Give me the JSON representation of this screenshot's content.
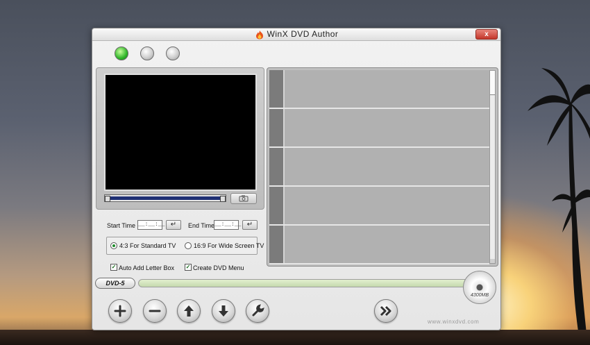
{
  "window": {
    "title": "WinX DVD Author",
    "close_label": "x"
  },
  "inputs": {
    "start_label": "Start Time :",
    "start_value": "__:__:__",
    "end_label": "End Time :",
    "end_value": "__:__:__",
    "enter_glyph": "↵"
  },
  "aspect": {
    "option_43": "4:3 For Standard TV",
    "option_169": "16:9 For Wide Screen TV",
    "selected": "4:3 For Standard TV"
  },
  "options": {
    "letterbox_label": "Auto Add Letter Box",
    "letterbox_checked": true,
    "menu_label": "Create DVD Menu",
    "menu_checked": true
  },
  "disc": {
    "type_label": "DVD-5",
    "capacity_label": "4300MB",
    "used_fraction": 0.0
  },
  "footer": {
    "website": "www.winxdvd.com"
  },
  "toolbar": {
    "icons": [
      "add-icon",
      "remove-icon",
      "move-up-icon",
      "move-down-icon",
      "wrench-icon",
      "next-icon"
    ]
  },
  "colors": {
    "accent_green": "#2fb52a",
    "seek_fill": "#1e2f74",
    "close_red": "#c3362a"
  }
}
